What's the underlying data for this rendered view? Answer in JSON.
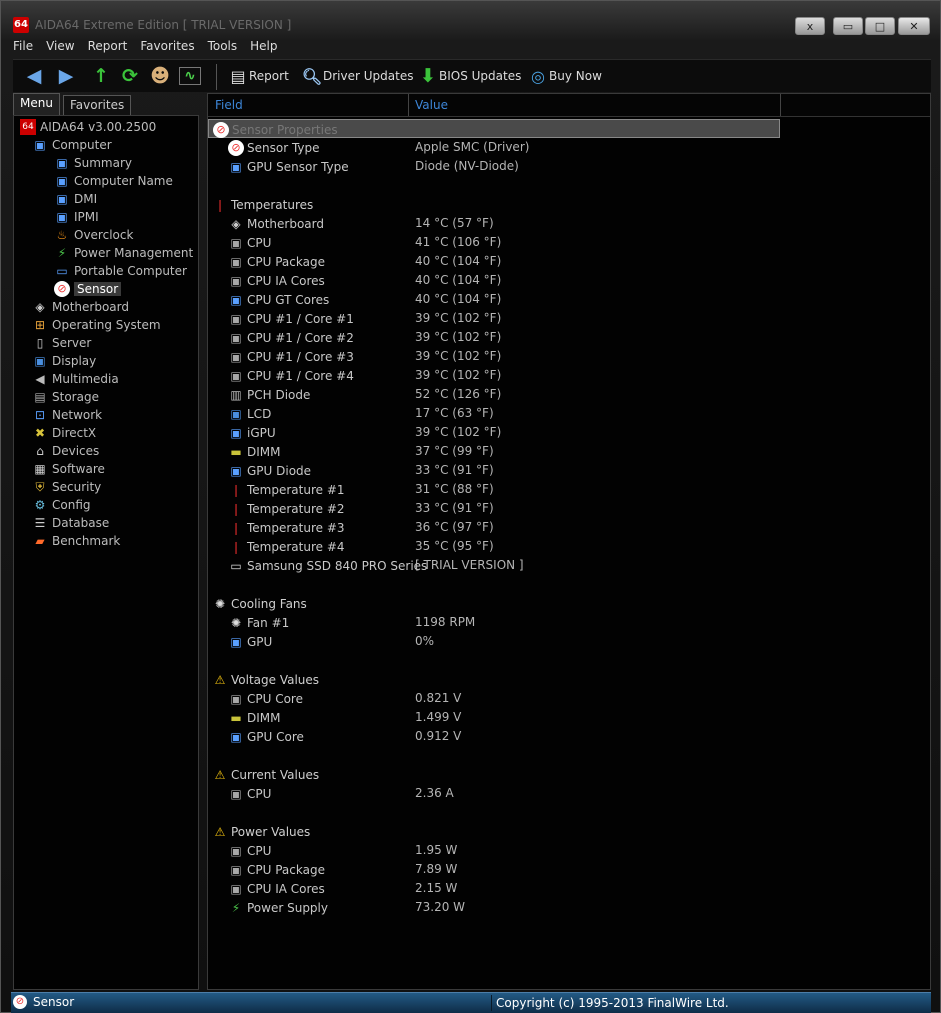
{
  "window": {
    "title": "AIDA64 Extreme Edition  [ TRIAL VERSION ]",
    "logo": "64",
    "buttons": {
      "extra": "x",
      "minimize": "▭",
      "maximize": "□",
      "close": "✕"
    }
  },
  "menu": [
    "File",
    "View",
    "Report",
    "Favorites",
    "Tools",
    "Help"
  ],
  "toolbar": {
    "report": "Report",
    "driver_updates": "Driver Updates",
    "bios_updates": "BIOS Updates",
    "buy_now": "Buy Now"
  },
  "tabs": {
    "menu": "Menu",
    "favorites": "Favorites"
  },
  "tree": [
    {
      "label": "AIDA64 v3.00.2500",
      "icon": "aida-logo-icon"
    },
    {
      "label": "Computer",
      "icon": "computer-icon"
    },
    {
      "label": "Summary",
      "icon": "computer-icon"
    },
    {
      "label": "Computer Name",
      "icon": "computer-icon"
    },
    {
      "label": "DMI",
      "icon": "computer-icon"
    },
    {
      "label": "IPMI",
      "icon": "computer-icon"
    },
    {
      "label": "Overclock",
      "icon": "flame-icon"
    },
    {
      "label": "Power Management",
      "icon": "power-plug-icon"
    },
    {
      "label": "Portable Computer",
      "icon": "laptop-icon"
    },
    {
      "label": "Sensor",
      "icon": "sensor-icon"
    },
    {
      "label": "Motherboard",
      "icon": "motherboard-icon"
    },
    {
      "label": "Operating System",
      "icon": "windows-icon"
    },
    {
      "label": "Server",
      "icon": "server-icon"
    },
    {
      "label": "Display",
      "icon": "monitor-icon"
    },
    {
      "label": "Multimedia",
      "icon": "speaker-icon"
    },
    {
      "label": "Storage",
      "icon": "storage-icon"
    },
    {
      "label": "Network",
      "icon": "network-icon"
    },
    {
      "label": "DirectX",
      "icon": "directx-icon"
    },
    {
      "label": "Devices",
      "icon": "devices-icon"
    },
    {
      "label": "Software",
      "icon": "software-icon"
    },
    {
      "label": "Security",
      "icon": "shield-icon"
    },
    {
      "label": "Config",
      "icon": "config-icon"
    },
    {
      "label": "Database",
      "icon": "database-icon"
    },
    {
      "label": "Benchmark",
      "icon": "benchmark-icon"
    }
  ],
  "columns": {
    "field": "Field",
    "value": "Value"
  },
  "rows": [
    {
      "field": "Sensor Properties",
      "value": "",
      "icon": "sensor-icon"
    },
    {
      "field": "Sensor Type",
      "value": "Apple SMC  (Driver)",
      "icon": "sensor-icon"
    },
    {
      "field": "GPU Sensor Type",
      "value": "Diode  (NV-Diode)",
      "icon": "gpu-icon"
    },
    {
      "field": "Temperatures",
      "value": "",
      "icon": "thermometer-icon"
    },
    {
      "field": "Motherboard",
      "value": "14 °C  (57 °F)",
      "icon": "motherboard-icon"
    },
    {
      "field": "CPU",
      "value": "41 °C  (106 °F)",
      "icon": "cpu-icon"
    },
    {
      "field": "CPU Package",
      "value": "40 °C  (104 °F)",
      "icon": "cpu-icon"
    },
    {
      "field": "CPU IA Cores",
      "value": "40 °C  (104 °F)",
      "icon": "cpu-icon"
    },
    {
      "field": "CPU GT Cores",
      "value": "40 °C  (104 °F)",
      "icon": "gpu-icon"
    },
    {
      "field": "CPU #1 / Core #1",
      "value": "39 °C  (102 °F)",
      "icon": "cpu-icon"
    },
    {
      "field": "CPU #1 / Core #2",
      "value": "39 °C  (102 °F)",
      "icon": "cpu-icon"
    },
    {
      "field": "CPU #1 / Core #3",
      "value": "39 °C  (102 °F)",
      "icon": "cpu-icon"
    },
    {
      "field": "CPU #1 / Core #4",
      "value": "39 °C  (102 °F)",
      "icon": "cpu-icon"
    },
    {
      "field": "PCH Diode",
      "value": "52 °C  (126 °F)",
      "icon": "chip-icon"
    },
    {
      "field": "LCD",
      "value": "17 °C  (63 °F)",
      "icon": "monitor-icon"
    },
    {
      "field": "iGPU",
      "value": "39 °C  (102 °F)",
      "icon": "gpu-icon"
    },
    {
      "field": "DIMM",
      "value": "37 °C  (99 °F)",
      "icon": "memory-icon"
    },
    {
      "field": "GPU Diode",
      "value": "33 °C  (91 °F)",
      "icon": "gpu-icon"
    },
    {
      "field": "Temperature #1",
      "value": "31 °C  (88 °F)",
      "icon": "thermometer-icon"
    },
    {
      "field": "Temperature #2",
      "value": "33 °C  (91 °F)",
      "icon": "thermometer-icon"
    },
    {
      "field": "Temperature #3",
      "value": "36 °C  (97 °F)",
      "icon": "thermometer-icon"
    },
    {
      "field": "Temperature #4",
      "value": "35 °C  (95 °F)",
      "icon": "thermometer-icon"
    },
    {
      "field": "Samsung SSD 840 PRO Series",
      "value": "[ TRIAL VERSION ]",
      "icon": "disk-icon"
    },
    {
      "field": "Cooling Fans",
      "value": "",
      "icon": "fan-icon"
    },
    {
      "field": "Fan #1",
      "value": "1198 RPM",
      "icon": "fan-icon"
    },
    {
      "field": "GPU",
      "value": "0%",
      "icon": "gpu-icon"
    },
    {
      "field": "Voltage Values",
      "value": "",
      "icon": "warning-icon"
    },
    {
      "field": "CPU Core",
      "value": "0.821 V",
      "icon": "cpu-icon"
    },
    {
      "field": "DIMM",
      "value": "1.499 V",
      "icon": "memory-icon"
    },
    {
      "field": "GPU Core",
      "value": "0.912 V",
      "icon": "gpu-icon"
    },
    {
      "field": "Current Values",
      "value": "",
      "icon": "warning-icon"
    },
    {
      "field": "CPU",
      "value": "2.36 A",
      "icon": "cpu-icon"
    },
    {
      "field": "Power Values",
      "value": "",
      "icon": "warning-icon"
    },
    {
      "field": "CPU",
      "value": "1.95 W",
      "icon": "cpu-icon"
    },
    {
      "field": "CPU Package",
      "value": "7.89 W",
      "icon": "cpu-icon"
    },
    {
      "field": "CPU IA Cores",
      "value": "2.15 W",
      "icon": "cpu-icon"
    },
    {
      "field": "Power Supply",
      "value": "73.20 W",
      "icon": "power-plug-icon"
    }
  ],
  "status": {
    "left": "Sensor",
    "right": "Copyright (c) 1995-2013 FinalWire Ltd."
  },
  "colors": {
    "accent": "#3d86d8",
    "background": "#000000",
    "text": "#c8c8c8",
    "status_bar": "#1b4a70"
  }
}
